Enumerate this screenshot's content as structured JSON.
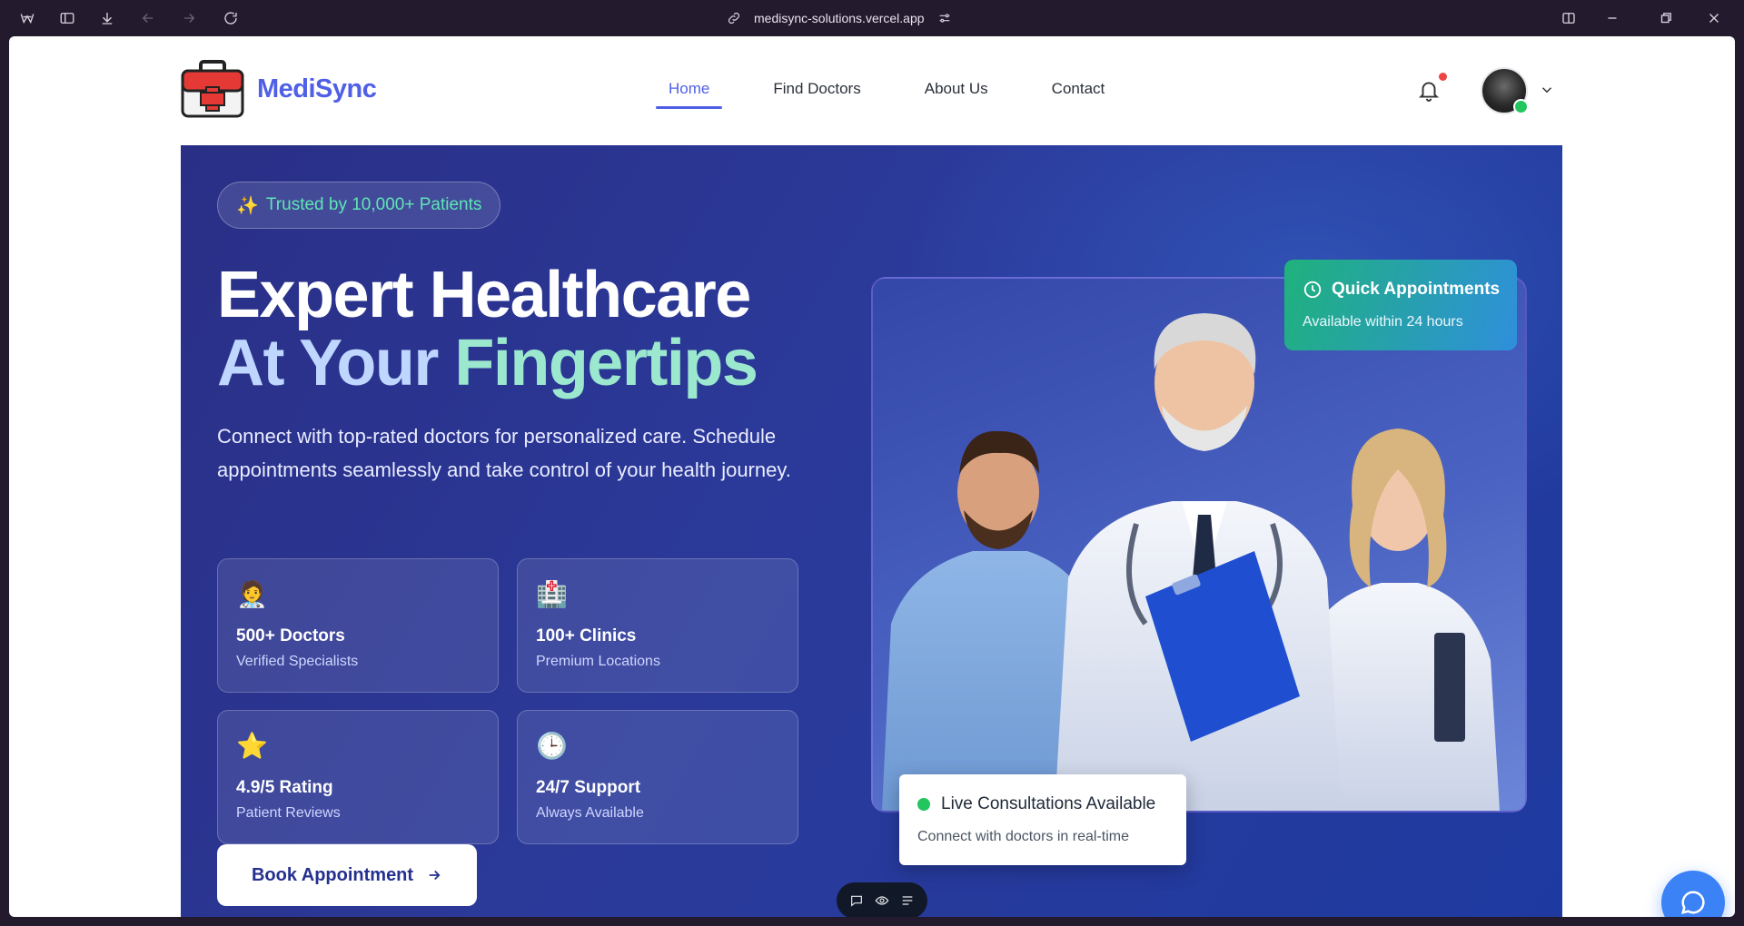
{
  "browser": {
    "url": "medisync-solutions.vercel.app"
  },
  "brand": {
    "name": "MediSync",
    "logo_icon": "first-aid-kit-icon",
    "color": "#4f5fe6"
  },
  "nav": {
    "links": [
      {
        "label": "Home",
        "active": true
      },
      {
        "label": "Find Doctors",
        "active": false
      },
      {
        "label": "About Us",
        "active": false
      },
      {
        "label": "Contact",
        "active": false
      }
    ]
  },
  "hero": {
    "badge": {
      "icon": "sparkles-icon",
      "text": "Trusted by 10,000+ Patients"
    },
    "headline_line1": "Expert Healthcare",
    "headline_line2_a": "At Your",
    "headline_line2_b": "Fingertips",
    "lead": "Connect with top-rated doctors for personalized care. Schedule appointments seamlessly and take control of your health journey.",
    "stats": [
      {
        "icon": "doctor-icon",
        "title": "500+ Doctors",
        "subtitle": "Verified Specialists"
      },
      {
        "icon": "hospital-icon",
        "title": "100+ Clinics",
        "subtitle": "Premium Locations"
      },
      {
        "icon": "star-icon",
        "title": "4.9/5 Rating",
        "subtitle": "Patient Reviews"
      },
      {
        "icon": "clock-icon",
        "title": "24/7 Support",
        "subtitle": "Always Available"
      }
    ],
    "cta": "Book Appointment",
    "quick_appointments": {
      "title": "Quick Appointments",
      "subtitle": "Available within 24 hours"
    },
    "live": {
      "title": "Live Consultations Available",
      "subtitle": "Connect with doctors in real-time"
    }
  },
  "colors": {
    "accent": "#4f5fe6",
    "hero_bg": "#2a2f86",
    "highlight_green": "#5ee6b4",
    "live_dot": "#22c55e",
    "chat_fab": "#3b82f6"
  }
}
